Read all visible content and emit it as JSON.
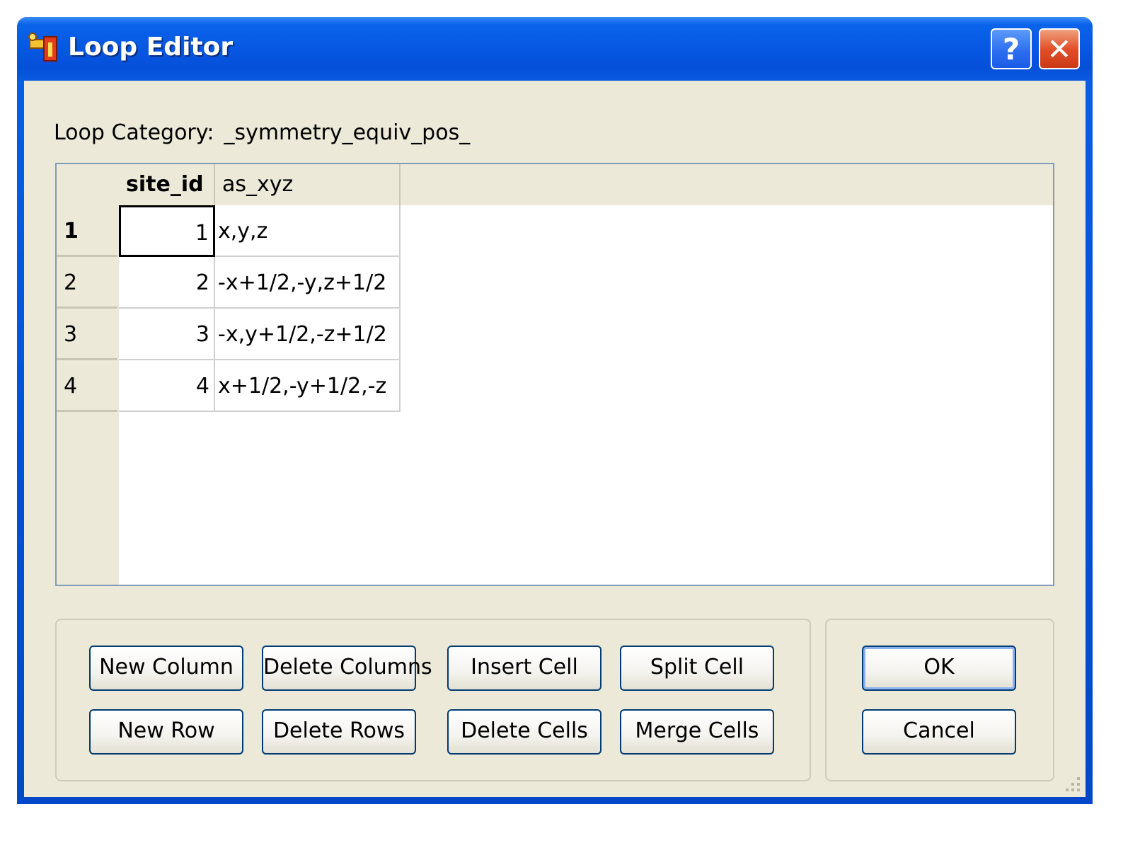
{
  "window": {
    "title": "Loop Editor",
    "help_label": "?",
    "close_label": "✕"
  },
  "loop": {
    "label": "Loop Category:",
    "category": "_symmetry_equiv_pos_"
  },
  "grid": {
    "columns": [
      "site_id",
      "as_xyz"
    ],
    "rows": [
      {
        "header": "1",
        "site_id": "1",
        "as_xyz": "x,y,z"
      },
      {
        "header": "2",
        "site_id": "2",
        "as_xyz": "-x+1/2,-y,z+1/2"
      },
      {
        "header": "3",
        "site_id": "3",
        "as_xyz": "-x,y+1/2,-z+1/2"
      },
      {
        "header": "4",
        "site_id": "4",
        "as_xyz": "x+1/2,-y+1/2,-z"
      }
    ],
    "selected": {
      "row": 1,
      "column": "site_id"
    }
  },
  "buttons": {
    "new_column": "New Column",
    "delete_columns": "Delete Columns",
    "insert_cell": "Insert Cell",
    "split_cell": "Split Cell",
    "new_row": "New Row",
    "delete_rows": "Delete Rows",
    "delete_cells": "Delete Cells",
    "merge_cells": "Merge Cells",
    "ok": "OK",
    "cancel": "Cancel"
  },
  "colors": {
    "titlebar": "#0554dc",
    "dialog_bg": "#ece9d8",
    "close_button": "#e2502a",
    "button_border": "#003c74"
  },
  "icons": {
    "app": "loop-editor-app-icon",
    "help": "help-icon",
    "close": "close-icon",
    "grip": "resize-grip-icon"
  }
}
